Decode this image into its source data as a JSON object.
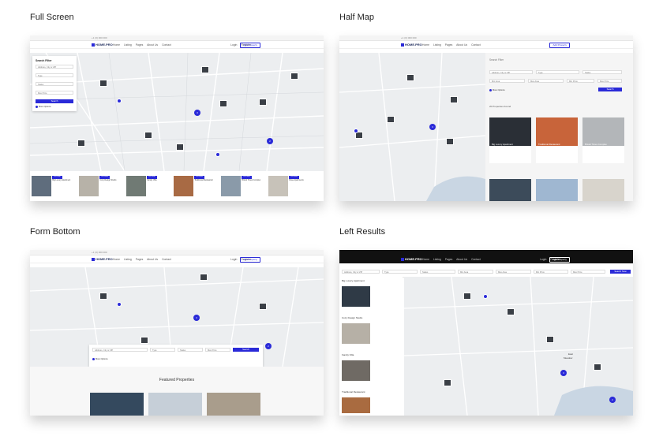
{
  "panels": [
    {
      "title": "Full Screen"
    },
    {
      "title": "Half Map"
    },
    {
      "title": "Form Bottom"
    },
    {
      "title": "Left Results"
    }
  ],
  "site": {
    "logo": "HOME.PRO",
    "phone": "+1 (0) 000 000",
    "email": "info@company.com",
    "nav": [
      "Home",
      "Listing",
      "Pages",
      "About Us",
      "Contact"
    ],
    "login": "Login",
    "register": "Register",
    "add_property": "Add Property"
  },
  "filters": {
    "title": "Search Filter",
    "address_placeholder": "Address, City or ZIP",
    "type": "Type",
    "status": "Status",
    "min_area": "Min Area",
    "max_area": "Max Area",
    "min_price": "Min Price",
    "max_price": "Max Price",
    "search": "Search",
    "search_now": "Search Now",
    "more_options": "More Options",
    "properties_found": "20 Properties Found"
  },
  "properties": [
    {
      "name": "Big Luxury Apartment",
      "tag": "For Sale"
    },
    {
      "name": "Cozy Design Studio",
      "tag": "For Rent"
    },
    {
      "name": "Family Villa",
      "tag": "For Sale"
    },
    {
      "name": "Traditional Restaurant",
      "tag": "For Rent"
    },
    {
      "name": "Bristol Times Complex",
      "tag": "For Sale"
    },
    {
      "name": "Rose Apartments",
      "tag": "For Rent"
    }
  ],
  "featured_title": "Featured Properties",
  "map_labels": {
    "east": "East",
    "meadow": "Meadow"
  },
  "colors": {
    "accent": "#2a2ad8",
    "marker": "#3a3f46",
    "map_bg": "#eceef0"
  }
}
